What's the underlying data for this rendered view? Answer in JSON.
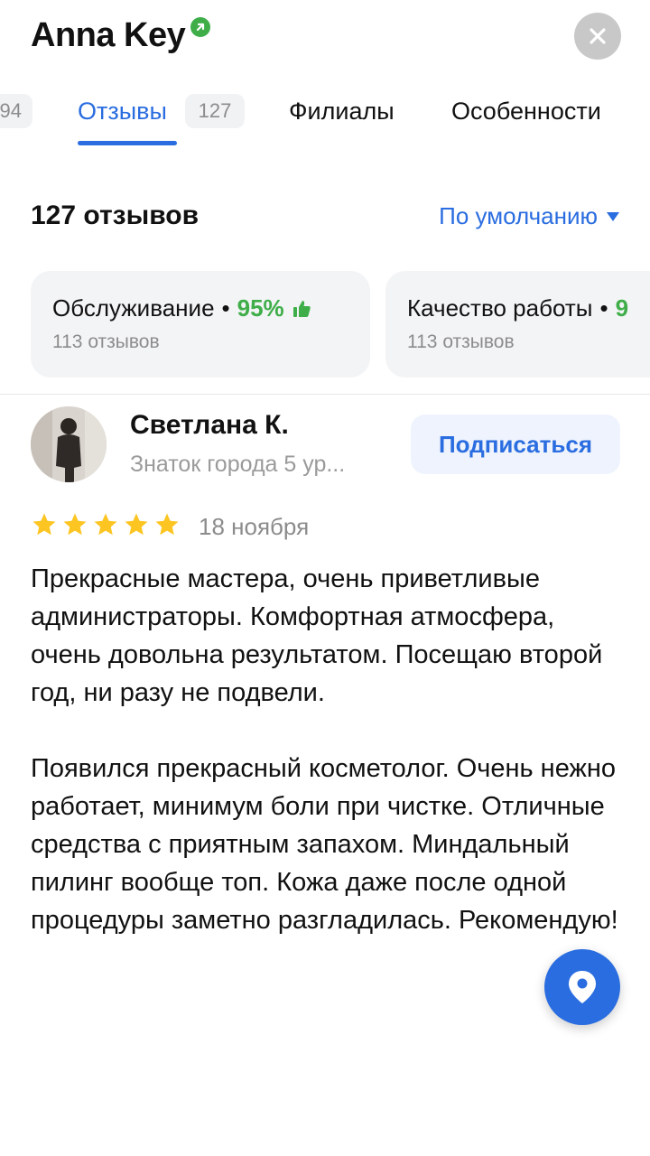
{
  "header": {
    "title": "Anna Key",
    "verified_icon": "verified-badge-icon",
    "close_icon": "close-icon"
  },
  "tabs": {
    "left_count": "94",
    "reviews_label": "Отзывы",
    "reviews_count": "127",
    "branches_label": "Филиалы",
    "features_label": "Особенности",
    "active_color": "#2a6de0"
  },
  "summary": {
    "count_label": "127 отзывов",
    "sort_label": "По умолчанию"
  },
  "aspects": [
    {
      "title": "Обслуживание",
      "percent": "95%",
      "sub": "113 отзывов",
      "icon": "thumbs-up-icon"
    },
    {
      "title": "Качество работы",
      "percent": "9",
      "sub": "113 отзывов"
    }
  ],
  "review": {
    "author": "Светлана К.",
    "level": "Знаток города 5 ур...",
    "subscribe_label": "Подписаться",
    "rating": 5,
    "date": "18 ноября",
    "text": "Прекрасные мастера, очень приветливые администраторы. Комфортная атмосфера, очень довольна результатом. Посещаю второй год, ни разу не подвели.\n\nПоявился прекрасный косметолог. Очень нежно работает, минимум боли при чистке. Отличные средства с приятным запахом. Миндальный пилинг вообще топ. Кожа даже после одной процедуры заметно разгладилась. Рекомендую!"
  },
  "fab": {
    "icon": "map-pin-icon"
  },
  "colors": {
    "accent": "#2a6de0",
    "positive": "#3fae49",
    "star": "#fcc521"
  }
}
